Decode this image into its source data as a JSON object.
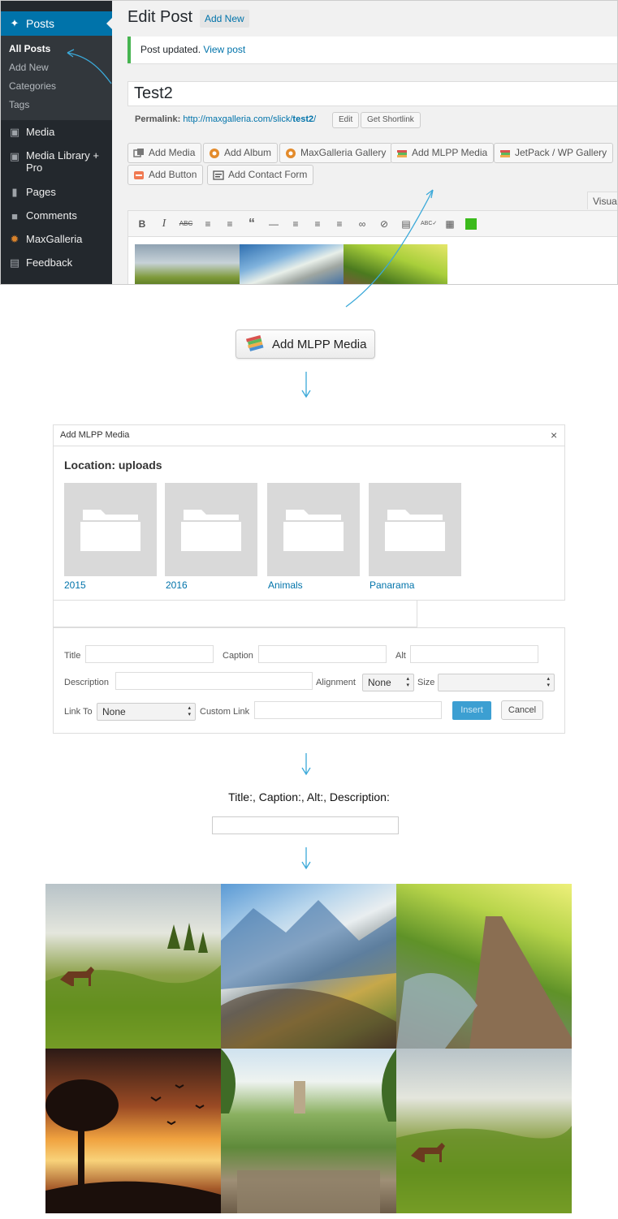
{
  "wp": {
    "sidebar": {
      "posts": "Posts",
      "sub": [
        "All Posts",
        "Add New",
        "Categories",
        "Tags"
      ],
      "media": "Media",
      "media_library": "Media Library +",
      "media_library_2": "Pro",
      "pages": "Pages",
      "comments": "Comments",
      "maxgalleria": "MaxGalleria",
      "feedback": "Feedback"
    },
    "page_title": "Edit Post",
    "add_new": "Add New",
    "notice": {
      "text": "Post updated.",
      "link": "View post"
    },
    "post_title": "Test2",
    "permalink": {
      "label": "Permalink:",
      "url_prefix": "http://maxgalleria.com/slick/",
      "slug": "test2",
      "url_suffix": "/",
      "edit": "Edit",
      "shortlink": "Get Shortlink"
    },
    "media_buttons": [
      "Add Media",
      "Add Album",
      "MaxGalleria Gallery",
      "Add MLPP Media",
      "JetPack / WP Gallery",
      "Add Button",
      "Add Contact Form"
    ],
    "visual_tab": "Visual",
    "toolbar_icons": [
      "bold-icon",
      "italic-icon",
      "strikethrough-icon",
      "bullet-list-icon",
      "numbered-list-icon",
      "blockquote-icon",
      "horizontal-rule-icon",
      "align-left-icon",
      "align-center-icon",
      "align-right-icon",
      "link-icon",
      "unlink-icon",
      "read-more-icon",
      "spellcheck-icon",
      "keyboard-icon",
      "color-square-icon"
    ]
  },
  "mlpp_button": "Add MLPP Media",
  "dialog": {
    "title": "Add MLPP Media",
    "close": "×",
    "location": "Location: uploads",
    "folders": [
      "2015",
      "2016",
      "Animals",
      "Panarama"
    ],
    "form": {
      "title": "Title",
      "caption": "Caption",
      "alt": "Alt",
      "description": "Description",
      "alignment": "Alignment",
      "alignment_value": "None",
      "size": "Size",
      "link_to": "Link To",
      "link_to_value": "None",
      "custom_link": "Custom Link",
      "insert": "Insert",
      "cancel": "Cancel"
    }
  },
  "fields_text": "Title:, Caption:, Alt:, Description:",
  "colors": {
    "wp_blue": "#0073aa",
    "sidebar": "#23282d",
    "arrow": "#3ba9d9",
    "insert": "#3c9fd2",
    "notice_green": "#46b450"
  }
}
